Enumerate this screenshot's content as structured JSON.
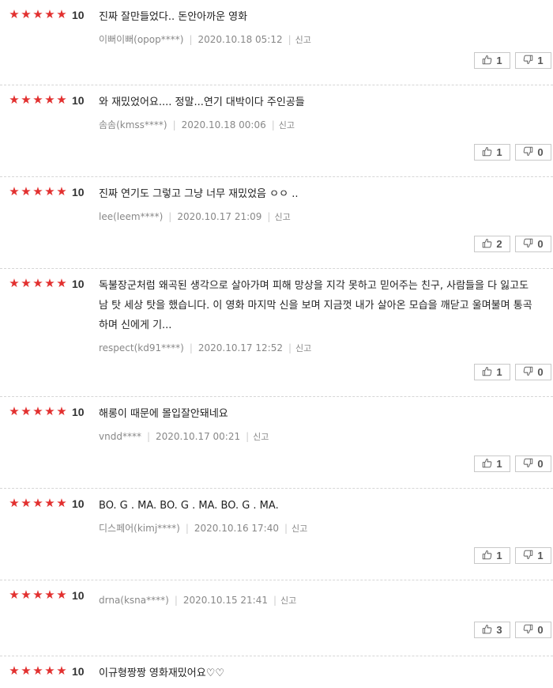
{
  "reviews": [
    {
      "stars": 5,
      "score": "10",
      "text": "진짜 잘만들었다.. 돈안아까운 영화",
      "author": "이뻐이뻐(opop****)",
      "date": "2020.10.18 05:12",
      "report": "신고",
      "likes": "1",
      "dislikes": "1"
    },
    {
      "stars": 5,
      "score": "10",
      "text": "와 재밌었어요.... 정말...연기 대박이다 주인공들",
      "author": "솜솜(kmss****)",
      "date": "2020.10.18 00:06",
      "report": "신고",
      "likes": "1",
      "dislikes": "0"
    },
    {
      "stars": 5,
      "score": "10",
      "text": "진짜 연기도 그렇고 그냥 너무 재밌었음 ㅇㅇ ..",
      "author": "lee(leem****)",
      "date": "2020.10.17 21:09",
      "report": "신고",
      "likes": "2",
      "dislikes": "0"
    },
    {
      "stars": 5,
      "score": "10",
      "text": "독불장군처럼 왜곡된 생각으로 살아가며 피해 망상을 지각 못하고 믿어주는 친구, 사람들을 다 잃고도 남 탓 세상 탓을 했습니다. 이 영화 마지막 신을 보며 지금껏 내가 살아온 모습을 깨닫고 울며불며 통곡하며 신에게 기...",
      "author": "respect(kd91****)",
      "date": "2020.10.17 12:52",
      "report": "신고",
      "likes": "1",
      "dislikes": "0"
    },
    {
      "stars": 5,
      "score": "10",
      "text": "해롱이 때문에 몰입잘안돼네요",
      "author": "vndd****",
      "date": "2020.10.17 00:21",
      "report": "신고",
      "likes": "1",
      "dislikes": "0"
    },
    {
      "stars": 5,
      "score": "10",
      "text": "BO. G . MA. BO. G . MA. BO. G . MA.",
      "author": "디스페어(kimj****)",
      "date": "2020.10.16 17:40",
      "report": "신고",
      "likes": "1",
      "dislikes": "1"
    },
    {
      "stars": 5,
      "score": "10",
      "text": "",
      "author": "drna(ksna****)",
      "date": "2020.10.15 21:41",
      "report": "신고",
      "likes": "3",
      "dislikes": "0"
    },
    {
      "stars": 5,
      "score": "10",
      "text": "이규형짱짱 영화재밌어요♡♡",
      "author": "",
      "date": "",
      "report": "",
      "likes": "",
      "dislikes": ""
    }
  ],
  "colors": {
    "star": "#e2302f",
    "text": "#222222",
    "meta": "#888888"
  },
  "icons": {
    "like": "thumbs-up-icon",
    "dislike": "thumbs-down-icon",
    "star": "star-icon"
  }
}
